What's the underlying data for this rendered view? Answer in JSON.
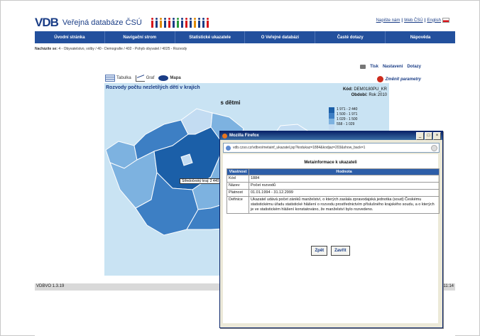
{
  "header": {
    "logo": "VDB",
    "title": "Veřejná databáze ČSÚ",
    "links": [
      "Napište nám",
      "Web ČSÚ",
      "English"
    ],
    "separator": "|"
  },
  "nav": [
    "Úvodní stránka",
    "Navigační strom",
    "Statistické ukazatele",
    "O Veřejné databázi",
    "Časté dotazy",
    "Nápověda"
  ],
  "breadcrumb": {
    "label": "Nacházíte se:",
    "path": "4 - Obyvatelstvo, volby / 40 - Demografie / 402 - Pohyb obyvatel / 4025 - Rozvody"
  },
  "tools": {
    "print": "Tisk",
    "settings": "Nastavení",
    "questions": "Dotazy",
    "change_params": "Změnit parametry"
  },
  "view_tabs": [
    "Tabulka",
    "Graf",
    "Mapa"
  ],
  "panel": {
    "title": "Rozvody počtu nezletilých dětí v krajích",
    "code_label": "Kód:",
    "code_value": "DEM0180PU_KR",
    "period_label": "Období:",
    "period_value": "Rok 2010",
    "subtitle": "s dětmi",
    "legend": [
      {
        "label": "1 971 - 2 440",
        "color": "#1b5fa8"
      },
      {
        "label": "1 500 - 1 971",
        "color": "#3d7fc4"
      },
      {
        "label": "1 029 - 1 500",
        "color": "#7db2e0"
      },
      {
        "label": "558 - 1 029",
        "color": "#c3dcf2"
      }
    ],
    "tooltip": "Středočeský kraj: 2 440"
  },
  "status_bar": {
    "version": "VDBVO 1.3.19",
    "middle": "©",
    "right": "11:14"
  },
  "popup": {
    "window_title": "Mozilla Firefox",
    "url": "vdb.czso.cz/vdbvo/metainf_ukazatel.jsp?kodukaz=1884&kodjaz=203&show_back=1",
    "heading": "Metainformace k ukazateli",
    "table_headers": [
      "Vlastnost",
      "Hodnota"
    ],
    "rows": [
      {
        "key": "Kód",
        "value": "1884"
      },
      {
        "key": "Název",
        "value": "Počet rozvodů"
      },
      {
        "key": "Platnost",
        "value": "01.01.1994 - 31.12.2999"
      },
      {
        "key": "Definice",
        "value": "Ukazatel udává počet zániků manželství, o kterých zaslala zpravodajská jednotka (soud) Českému statistickému úřadu statistické hlášení o rozvodu prostřednictvím příslušného krajského soudu, a o kterých je ve statistickém hlášení konstatováno, že manželství bylo rozvedeno."
      }
    ],
    "back_button": "Zpět",
    "close_button": "Zavřít"
  },
  "colors": {
    "brand": "#1a3d86",
    "nav_bg": "#23509d",
    "panel_bg": "#c9e3f3",
    "accent_red": "#cc2b1d"
  }
}
